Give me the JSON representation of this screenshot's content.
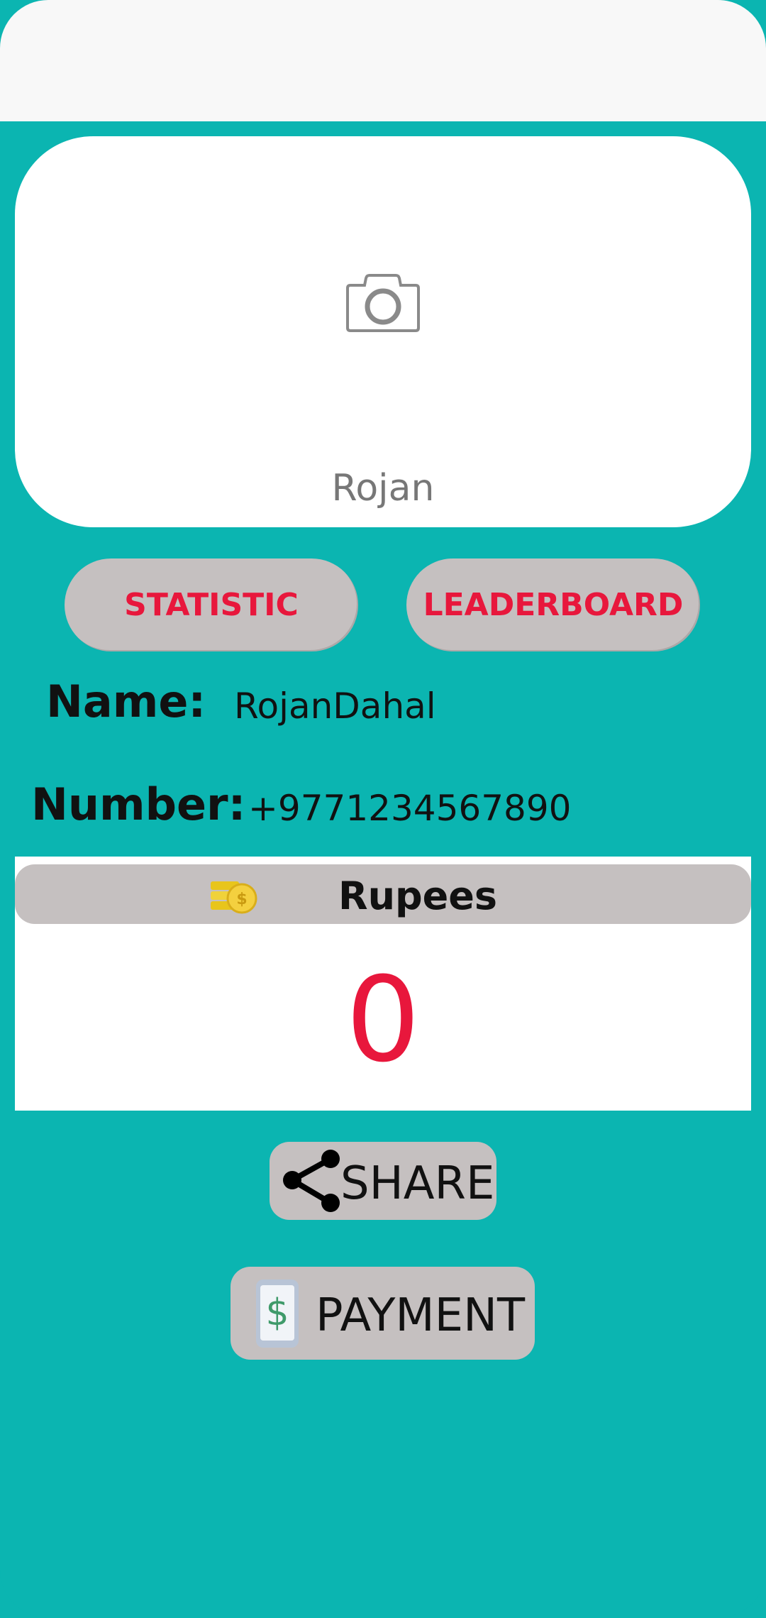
{
  "profile": {
    "display_name": "Rojan",
    "photo_icon": "camera-icon"
  },
  "buttons": {
    "statistic_label": "STATISTIC",
    "leaderboard_label": "LEADERBOARD",
    "share_label": "SHARE",
    "payment_label": "PAYMENT"
  },
  "info": {
    "name_label": "Name:",
    "name_value": "RojanDahal",
    "number_label": "Number:",
    "number_value": "+9771234567890"
  },
  "wallet": {
    "title": "Rupees",
    "icon": "coins-icon",
    "amount": "0"
  },
  "colors": {
    "background": "#0bb5b1",
    "accent_red": "#e8173c",
    "button_gray": "#c5c0c0"
  }
}
